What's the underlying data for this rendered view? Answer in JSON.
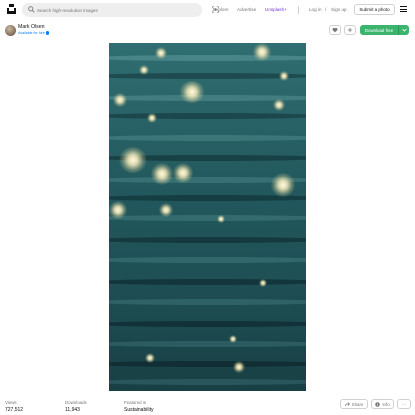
{
  "header": {
    "search_placeholder": "Search high-resolution images",
    "nav": {
      "explore": "Explore",
      "advertise": "Advertise",
      "unsplash_plus": "Unsplash+",
      "login": "Log in",
      "separator": "/",
      "signup": "Sign up",
      "submit": "Submit a photo"
    }
  },
  "author": {
    "name": "Mark Olsen",
    "hire_label": "Available for hire"
  },
  "actions": {
    "download_label": "Download free",
    "share_label": "Share",
    "info_label": "Info",
    "more_label": "···"
  },
  "stats": {
    "views_label": "Views",
    "views_value": "727,512",
    "downloads_label": "Downloads",
    "downloads_value": "11,943",
    "featured_label": "Featured in",
    "featured_value": "Sustainability"
  },
  "colors": {
    "accent_green": "#3cb46e",
    "unsplash_plus": "#7a38d8",
    "hire_blue": "#007fff",
    "water": "#22595e"
  },
  "icons": [
    "unsplash-logo",
    "search-icon",
    "visual-search-icon",
    "menu-icon",
    "verified-check-icon",
    "heart-icon",
    "plus-icon",
    "chevron-down-icon",
    "share-icon",
    "info-icon"
  ]
}
